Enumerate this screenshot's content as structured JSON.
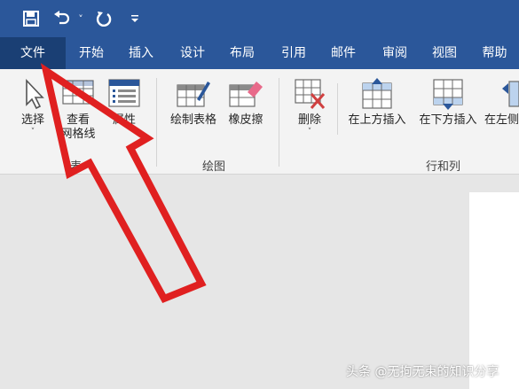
{
  "quick_access": {
    "icons": [
      "save-icon",
      "undo-icon",
      "redo-icon",
      "customize-icon"
    ],
    "undo_dropdown": "˅"
  },
  "tabs": [
    {
      "label": "文件",
      "active": true
    },
    {
      "label": "开始"
    },
    {
      "label": "插入"
    },
    {
      "label": "设计"
    },
    {
      "label": "布局"
    },
    {
      "label": "引用"
    },
    {
      "label": "邮件"
    },
    {
      "label": "审阅"
    },
    {
      "label": "视图"
    },
    {
      "label": "帮助"
    }
  ],
  "ribbon": {
    "groups": {
      "table": {
        "label": "表",
        "buttons": {
          "select": {
            "label": "选择",
            "caret": "˅"
          },
          "view_gridlines": {
            "label1": "查看",
            "label2": "网格线"
          },
          "properties": {
            "label": "属性"
          }
        }
      },
      "draw": {
        "label": "绘图",
        "buttons": {
          "draw_table": {
            "label": "绘制表格"
          },
          "eraser": {
            "label": "橡皮擦"
          }
        }
      },
      "rows_columns": {
        "label": "行和列",
        "buttons": {
          "delete": {
            "label": "删除",
            "caret": "˅"
          },
          "insert_above": {
            "label": "在上方插入"
          },
          "insert_below": {
            "label": "在下方插入"
          },
          "insert_left": {
            "label": "在左侧"
          }
        }
      }
    }
  },
  "watermark": "头条 @无拘无束的知识分享",
  "colors": {
    "title_bar": "#2b579a",
    "active_tab": "#1a3f74",
    "arrow": "#e02020",
    "ribbon": "#f3f3f3"
  }
}
